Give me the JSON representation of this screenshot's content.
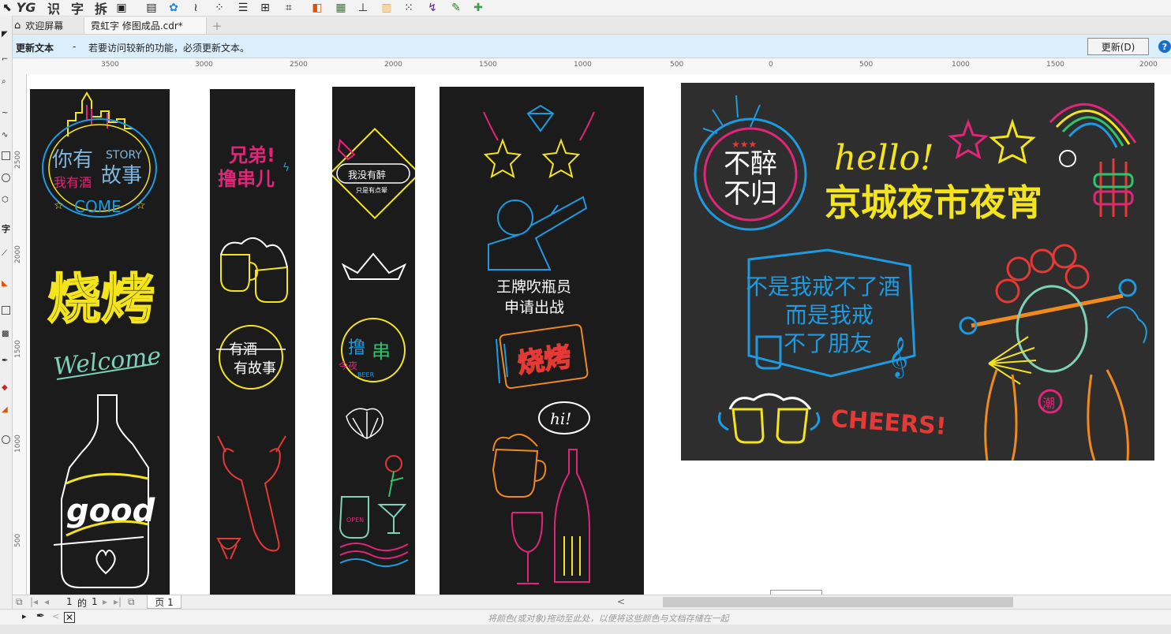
{
  "toolbar": {
    "items": [
      "YG",
      "识",
      "字",
      "拆"
    ]
  },
  "tabs": {
    "welcome": "欢迎屏幕",
    "document": "霓虹字 修图成品.cdr*",
    "add": "+"
  },
  "update_bar": {
    "title": "更新文本",
    "dash": "-",
    "message": "若要访问较新的功能，必须更新文本。",
    "button": "更新(D)",
    "help": "?"
  },
  "ruler": {
    "h_labels": [
      "3500",
      "3000",
      "2500",
      "2000",
      "1500",
      "1000",
      "500",
      "0",
      "500",
      "1000",
      "1500",
      "2000"
    ],
    "v_labels": [
      "2500",
      "2000",
      "1500",
      "1000",
      "500"
    ]
  },
  "artwork": {
    "p1": {
      "story": "STORY",
      "you": "你有",
      "gushi": "故事",
      "wine": "我有酒",
      "come": "COME",
      "bbq": "烧烤",
      "welcome": "Welcome",
      "good": "good"
    },
    "p2": {
      "brother": "兄弟!",
      "skewer": "撸串儿",
      "story1": "有酒",
      "story2": "有故事"
    },
    "p3": {
      "drunk": "我没有醉",
      "drunk2": "只是有点晕",
      "lu": "撸",
      "chuan": "串",
      "tonight": "今夜",
      "beer": "BEER",
      "open": "OPEN"
    },
    "p4": {
      "ace1": "王牌吹瓶员",
      "ace2": "申请出战",
      "bbq": "烧烤",
      "hi": "hi!"
    },
    "p5": {
      "bz1": "不醉",
      "bz2": "不归",
      "hello": "hello!",
      "market": "京城夜市夜宵",
      "q1": "不是我戒不了酒",
      "q2": "而是我戒",
      "q3": "不了朋友",
      "cheers": "CHEERS!",
      "chao": "潮"
    }
  },
  "page_nav": {
    "current": "1",
    "of": "的",
    "total": "1",
    "page_tab": "页 1"
  },
  "status": {
    "hint": "将颜色(或对象)拖动至此处，以便将这些颜色与文档存储在一起"
  },
  "colors": {
    "panel_bg": "#1b1b1b",
    "panel5_bg": "#2e2e2e",
    "neon_yellow": "#f4e41c",
    "neon_blue": "#1e9be0",
    "neon_pink": "#e0257a",
    "neon_red": "#e53935",
    "neon_orange": "#f08a1c",
    "neon_green": "#2ec46a",
    "update_bar": "#dbeefb"
  }
}
